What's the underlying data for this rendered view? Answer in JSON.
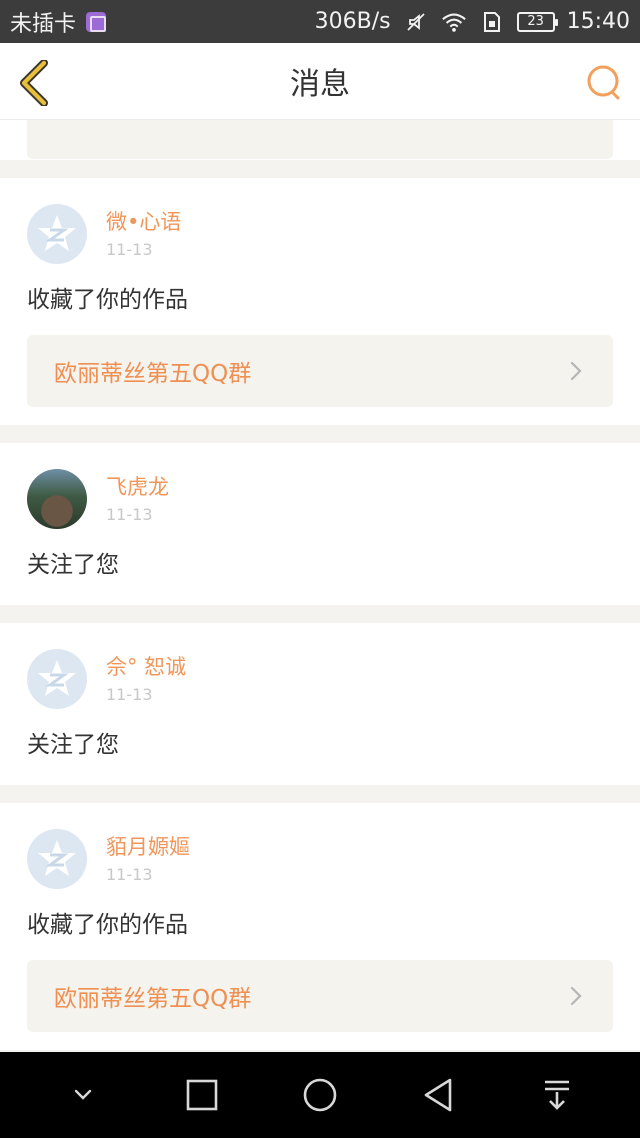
{
  "status_bar": {
    "carrier": "未插卡",
    "net_speed": "306B/s",
    "battery": "23",
    "time": "15:40"
  },
  "header": {
    "title": "消息"
  },
  "messages": [
    {
      "name": "微•心语",
      "date": "11-13",
      "action": "收藏了你的作品",
      "link": "欧丽蒂丝第五QQ群"
    },
    {
      "name": "飞虎龙",
      "date": "11-13",
      "action": "关注了您"
    },
    {
      "name": "佘° 恕诚",
      "date": "11-13",
      "action": "关注了您"
    },
    {
      "name": "貊月嫄嫗",
      "date": "11-13",
      "action": "收藏了你的作品",
      "link": "欧丽蒂丝第五QQ群"
    }
  ],
  "colors": {
    "accent": "#f0965a",
    "link_bg": "#f4f3ee",
    "page_bg": "#f4f3f0",
    "back_icon": "#e0b53a"
  },
  "icons": {
    "back": "chevron-left-icon",
    "search": "search-icon",
    "default_avatar": "qzone-star-icon",
    "link_arrow": "chevron-right-icon"
  }
}
